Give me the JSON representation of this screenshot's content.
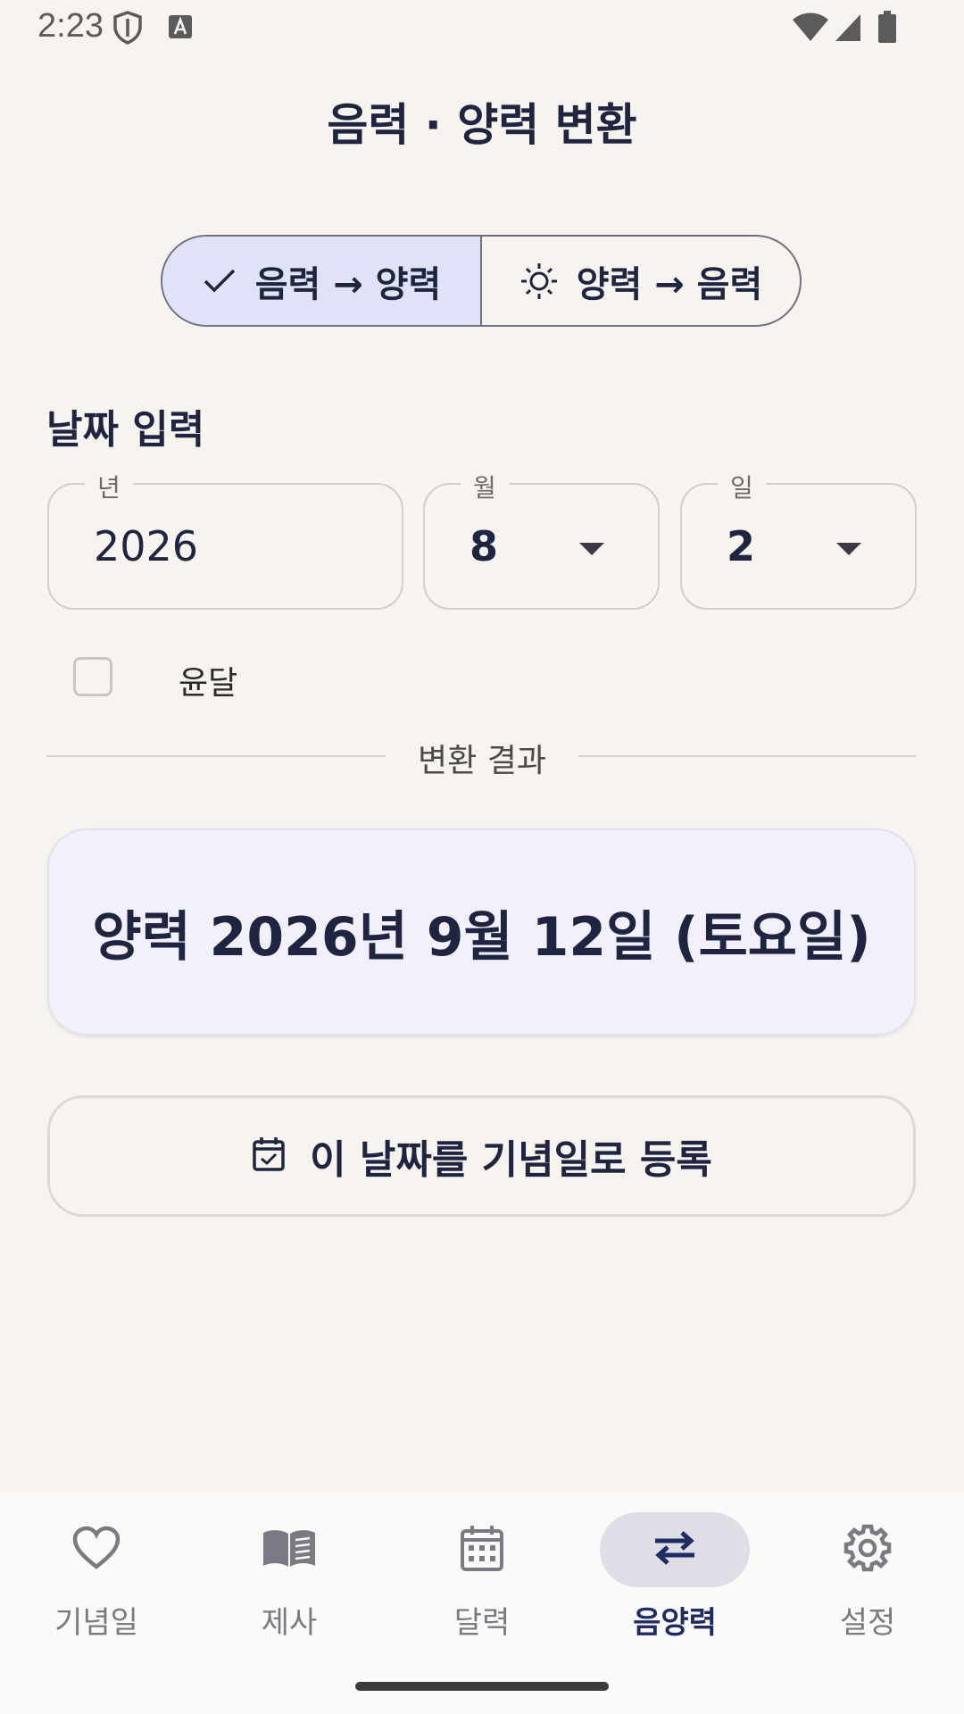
{
  "status_bar": {
    "time": "2:23"
  },
  "header": {
    "title": "음력 · 양력 변환"
  },
  "mode_toggle": {
    "options": [
      {
        "label": "음력 → 양력",
        "icon": "check-icon",
        "selected": true
      },
      {
        "label": "양력 → 음력",
        "icon": "sun-icon",
        "selected": false
      }
    ]
  },
  "date_input": {
    "section_label": "날짜 입력",
    "year": {
      "label": "년",
      "value": "2026"
    },
    "month": {
      "label": "월",
      "value": "8"
    },
    "day": {
      "label": "일",
      "value": "2"
    },
    "leap_month": {
      "label": "윤달",
      "checked": false
    }
  },
  "result": {
    "divider_label": "변환 결과",
    "text": "양력 2026년 9월 12일 (토요일)"
  },
  "register_button": {
    "label": "이 날짜를 기념일로 등록",
    "icon": "calendar-check-icon"
  },
  "bottom_nav": {
    "items": [
      {
        "label": "기념일",
        "icon": "heart-icon",
        "active": false
      },
      {
        "label": "제사",
        "icon": "book-icon",
        "active": false
      },
      {
        "label": "달력",
        "icon": "calendar-icon",
        "active": false
      },
      {
        "label": "음양력",
        "icon": "swap-icon",
        "active": true
      },
      {
        "label": "설정",
        "icon": "gear-icon",
        "active": false
      }
    ]
  },
  "colors": {
    "background": "#f7f3ef",
    "accent": "#1f2b63",
    "selected_segment": "#e0e2f7",
    "result_card": "#f1f0fb"
  }
}
